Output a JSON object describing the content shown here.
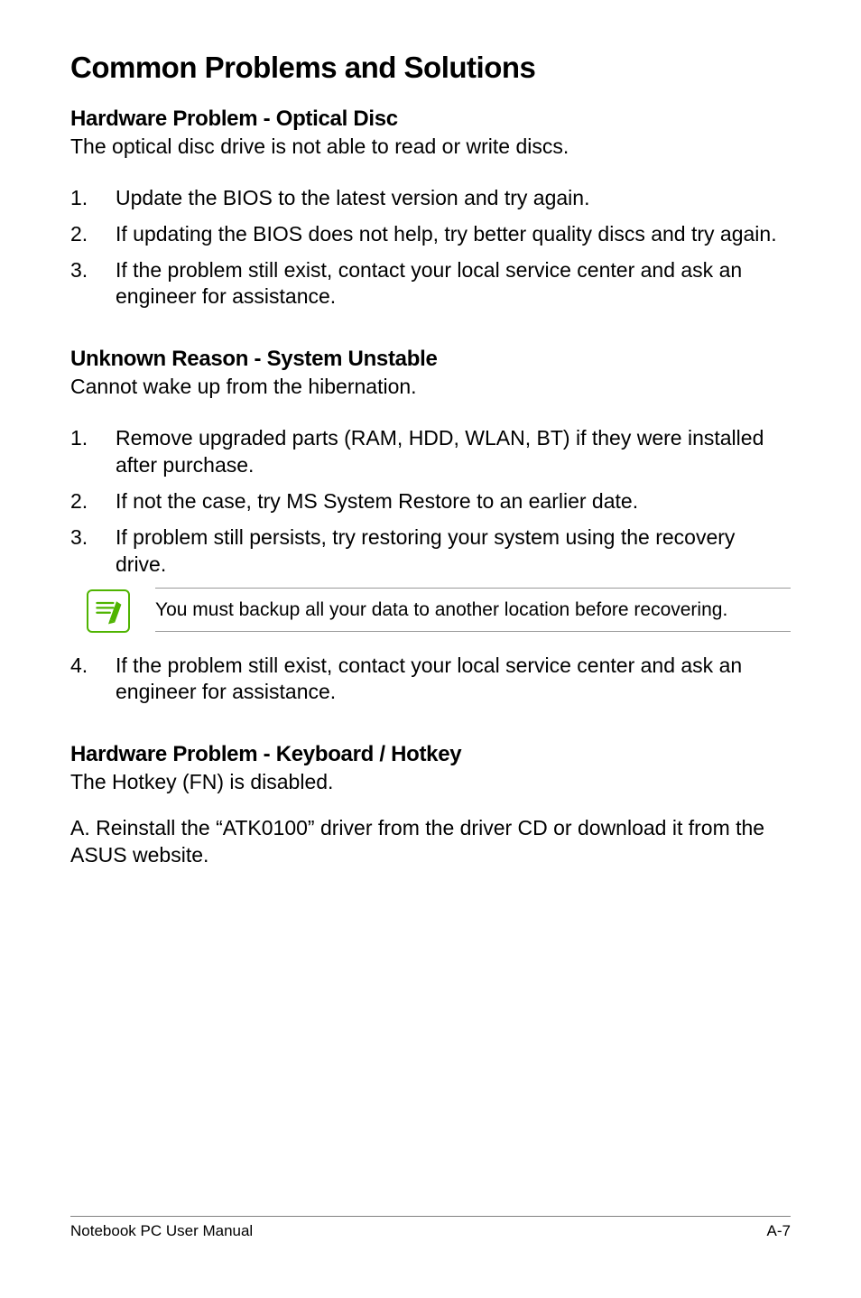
{
  "title": "Common Problems and Solutions",
  "sections": [
    {
      "heading": "Hardware Problem - Optical Disc",
      "intro": "The optical disc drive is not able to read or write discs.",
      "items": [
        "Update the BIOS to the latest version and try again.",
        "If updating the BIOS does not help, try better quality discs and try again.",
        "If the problem still exist, contact your local service center and ask an engineer for assistance."
      ]
    },
    {
      "heading": "Unknown Reason - System Unstable",
      "intro": "Cannot wake up from the hibernation.",
      "items": [
        "Remove upgraded parts (RAM, HDD, WLAN, BT) if they were installed after purchase.",
        "If not the case, try MS System Restore to an earlier date.",
        "If problem still persists, try restoring your system using the recovery drive."
      ],
      "note": "You must backup all your data to another location before recovering.",
      "after_items": [
        "If the problem still exist, contact your local service center and ask an engineer for assistance."
      ],
      "after_start": 4
    },
    {
      "heading": "Hardware Problem - Keyboard / Hotkey",
      "intro": "The Hotkey (FN) is disabled.",
      "paragraph": "A. Reinstall the “ATK0100” driver from the driver CD or download it from the ASUS website."
    }
  ],
  "footer": {
    "left": "Notebook PC User Manual",
    "right": "A-7"
  }
}
